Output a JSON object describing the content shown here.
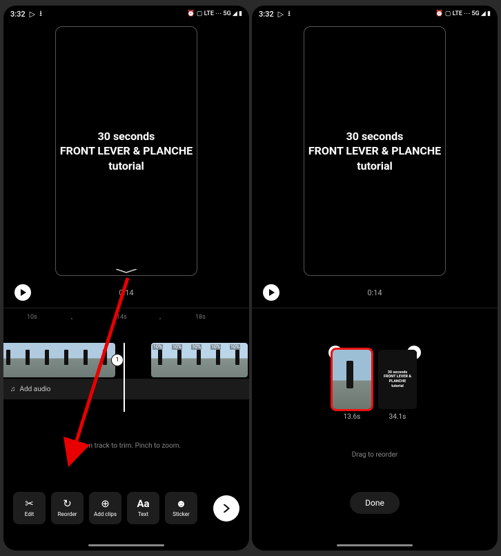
{
  "status": {
    "time": "3:32",
    "icons_right": "⏰ ▢ LTE ⋯ 5G ◢ ▮"
  },
  "preview": {
    "line1": "30 seconds",
    "line2": "FRONT LEVER & PLANCHE",
    "line3": "tutorial"
  },
  "playback": {
    "time": "0:14"
  },
  "ruler": {
    "t1": "10s",
    "t2": "14s",
    "t3": "18s"
  },
  "clip_badge": "1",
  "audio": {
    "label": "Add audio"
  },
  "hint_left": "Tap on track to trim. Pinch to zoom.",
  "tools": {
    "edit": "Edit",
    "reorder": "Reorder",
    "addclips": "Add clips",
    "text": "Text",
    "sticker": "Sticker"
  },
  "reorder": {
    "item1_dur": "13.6s",
    "item2_dur": "34.1s",
    "mini_text": "30 seconds\nFRONT LEVER & PLANCHE\ntutorial",
    "hint": "Drag to reorder",
    "done": "Done"
  },
  "clip2_pct": "10%"
}
